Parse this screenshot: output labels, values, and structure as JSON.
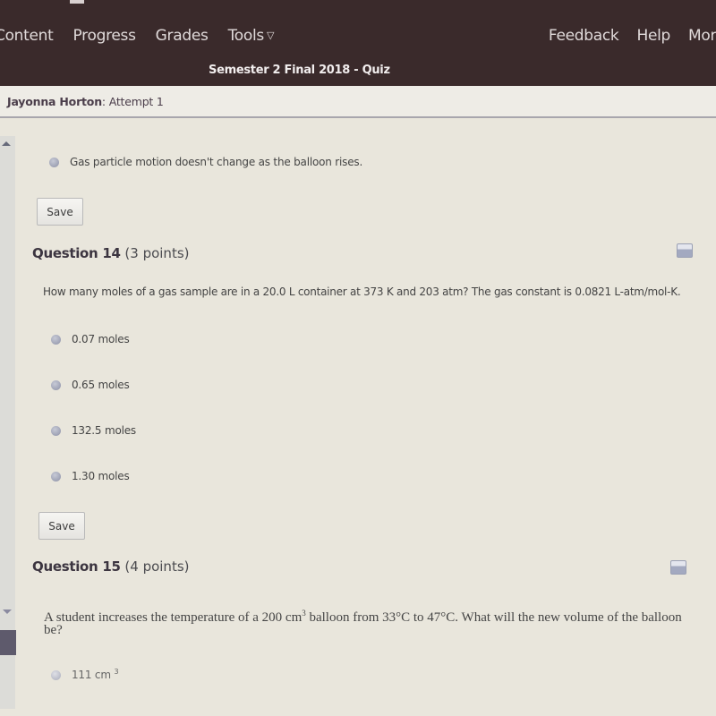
{
  "nav": {
    "items": [
      {
        "label": "Content"
      },
      {
        "label": "Progress"
      },
      {
        "label": "Grades"
      },
      {
        "label": "Tools",
        "has_dropdown": true
      }
    ],
    "right_items": [
      {
        "label": "Feedback"
      },
      {
        "label": "Help"
      },
      {
        "label": "More"
      }
    ],
    "quiz_title": "Semester 2 Final 2018 - Quiz"
  },
  "attempt": {
    "student_name": "Jayonna Horton",
    "suffix": ": Attempt 1"
  },
  "previous_question": {
    "last_option": "Gas particle motion doesn't change as the balloon rises.",
    "save_label": "Save"
  },
  "questions": [
    {
      "title": "Question 14",
      "points": "(3 points)",
      "text": "How many moles of a gas sample are in a 20.0 L container at 373 K and 203 atm? The gas constant is 0.0821 L-atm/mol-K.",
      "options": [
        "0.07 moles",
        "0.65 moles",
        "132.5 moles",
        "1.30 moles"
      ],
      "save_label": "Save"
    },
    {
      "title": "Question 15",
      "points": "(4 points)",
      "text_before_sup": "A student increases the temperature of a 200 cm",
      "text_sup": "3",
      "text_after_sup": " balloon from 33°C to 47°C. What will the new volume of the balloon be?",
      "options": [
        {
          "value": "111 cm",
          "sup": "3"
        }
      ]
    }
  ],
  "colors": {
    "header_bg": "#3a2a2b",
    "page_bg": "#e9e6dc",
    "scroll_thumb": "#5e5a6c"
  }
}
